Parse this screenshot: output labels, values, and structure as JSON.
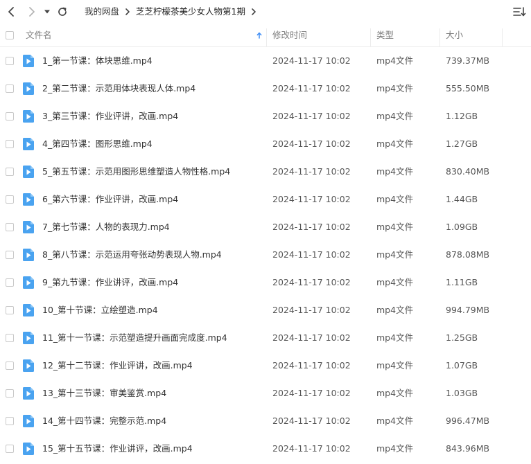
{
  "nav": {
    "back_icon": "chevron-left-icon",
    "forward_icon": "chevron-right-icon",
    "history_icon": "caret-down-icon",
    "refresh_icon": "refresh-icon"
  },
  "breadcrumb": [
    {
      "label": "我的网盘"
    },
    {
      "label": "芝芝柠檬茶美少女人物第1期"
    }
  ],
  "toolbar": {
    "sort_icon": "sort-list-icon"
  },
  "table": {
    "headers": {
      "name": "文件名",
      "modified": "修改时间",
      "type": "类型",
      "size": "大小"
    },
    "sort_indicator_icon": "arrow-up-icon",
    "rows": [
      {
        "name": "1_第一节课：体块思维.mp4",
        "modified": "2024-11-17 10:02",
        "type": "mp4文件",
        "size": "739.37MB"
      },
      {
        "name": "2_第二节课：示范用体块表现人体.mp4",
        "modified": "2024-11-17 10:02",
        "type": "mp4文件",
        "size": "555.50MB"
      },
      {
        "name": "3_第三节课：作业评讲，改画.mp4",
        "modified": "2024-11-17 10:02",
        "type": "mp4文件",
        "size": "1.12GB"
      },
      {
        "name": "4_第四节课：图形思维.mp4",
        "modified": "2024-11-17 10:02",
        "type": "mp4文件",
        "size": "1.27GB"
      },
      {
        "name": "5_第五节课：示范用图形思维塑造人物性格.mp4",
        "modified": "2024-11-17 10:02",
        "type": "mp4文件",
        "size": "830.40MB"
      },
      {
        "name": "6_第六节课：作业评讲，改画.mp4",
        "modified": "2024-11-17 10:02",
        "type": "mp4文件",
        "size": "1.44GB"
      },
      {
        "name": "7_第七节课：人物的表现力.mp4",
        "modified": "2024-11-17 10:02",
        "type": "mp4文件",
        "size": "1.09GB"
      },
      {
        "name": "8_第八节课：示范运用夸张动势表现人物.mp4",
        "modified": "2024-11-17 10:02",
        "type": "mp4文件",
        "size": "878.08MB"
      },
      {
        "name": "9_第九节课：作业讲评，改画.mp4",
        "modified": "2024-11-17 10:02",
        "type": "mp4文件",
        "size": "1.11GB"
      },
      {
        "name": "10_第十节课：立绘塑造.mp4",
        "modified": "2024-11-17 10:02",
        "type": "mp4文件",
        "size": "994.79MB"
      },
      {
        "name": "11_第十一节课：示范塑造提升画面完成度.mp4",
        "modified": "2024-11-17 10:02",
        "type": "mp4文件",
        "size": "1.25GB"
      },
      {
        "name": "12_第十二节课：作业评讲，改画.mp4",
        "modified": "2024-11-17 10:02",
        "type": "mp4文件",
        "size": "1.07GB"
      },
      {
        "name": "13_第十三节课：审美鉴赏.mp4",
        "modified": "2024-11-17 10:02",
        "type": "mp4文件",
        "size": "1.03GB"
      },
      {
        "name": "14_第十四节课：完整示范.mp4",
        "modified": "2024-11-17 10:02",
        "type": "mp4文件",
        "size": "996.47MB"
      },
      {
        "name": "15_第十五节课：作业讲评，改画.mp4",
        "modified": "2024-11-17 10:02",
        "type": "mp4文件",
        "size": "843.96MB"
      }
    ]
  },
  "colors": {
    "accent": "#3f8ef5",
    "file_icon": "#4aa3f0",
    "divider": "#ececec"
  }
}
